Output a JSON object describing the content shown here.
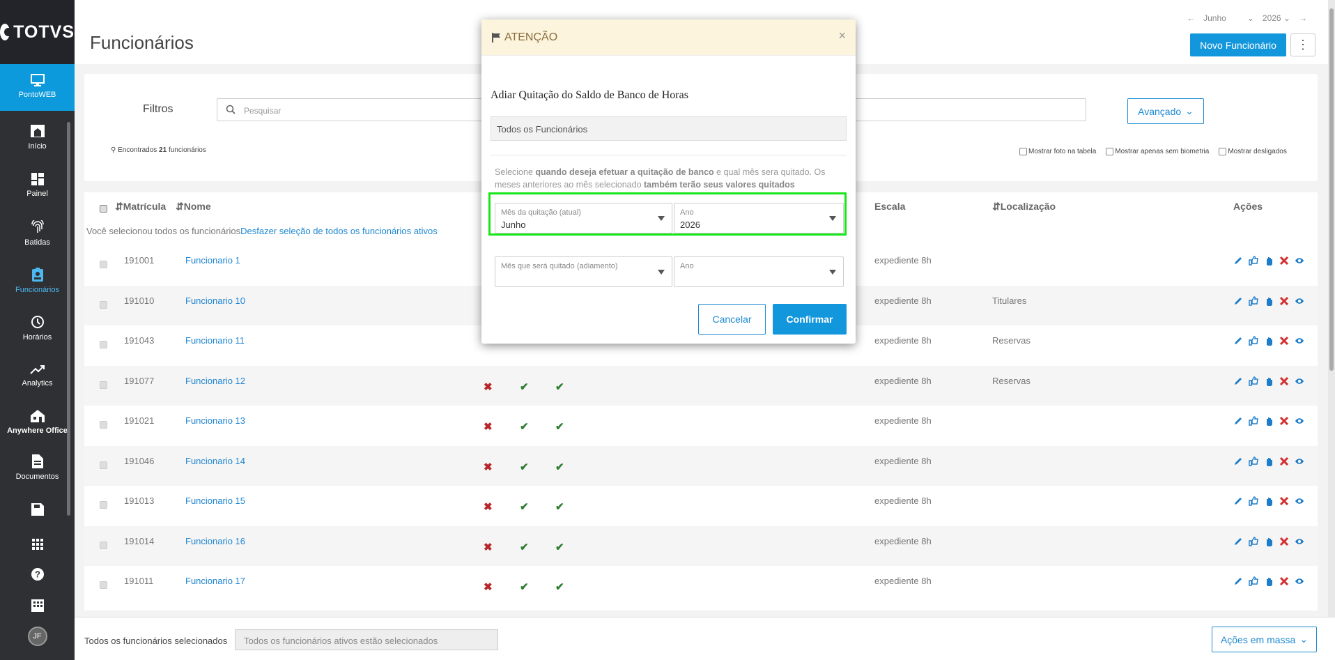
{
  "sidebar": {
    "brand": "TOTVS",
    "items": [
      {
        "label": "PontoWEB"
      },
      {
        "label": "Início"
      },
      {
        "label": "Painel"
      },
      {
        "label": "Batidas"
      },
      {
        "label": "Funcionários"
      },
      {
        "label": "Horários"
      },
      {
        "label": "Analytics"
      },
      {
        "label": "Anywhere Office"
      },
      {
        "label": "Documentos"
      }
    ],
    "avatar": "JF"
  },
  "header": {
    "title": "Funcionários",
    "month": "Junho",
    "year": "2026",
    "new_button": "Novo Funcionário"
  },
  "filters": {
    "label": "Filtros",
    "search_placeholder": "Pesquisar",
    "advanced": "Avançado",
    "found_prefix": "Encontrados ",
    "found_count": "21",
    "found_suffix": " funcionários",
    "check_photo": "Mostrar foto na tabela",
    "check_biometry": "Mostrar apenas sem biometria",
    "check_dismissed": "Mostrar desligados"
  },
  "table": {
    "headers": {
      "matricula": "Matrícula",
      "nome": "Nome",
      "escala": "Escala",
      "localizacao": "Localização",
      "acoes": "Ações"
    },
    "selection_text": "Você selecionou todos os funcionários",
    "selection_link": "Desfazer seleção de todos os funcionários ativos",
    "rows": [
      {
        "matricula": "191001",
        "nome": "Funcionario 1",
        "escala": "expediente 8h",
        "localizacao": ""
      },
      {
        "matricula": "191010",
        "nome": "Funcionario 10",
        "escala": "expediente 8h",
        "localizacao": "Titulares"
      },
      {
        "matricula": "191043",
        "nome": "Funcionario 11",
        "escala": "expediente 8h",
        "localizacao": "Reservas"
      },
      {
        "matricula": "191077",
        "nome": "Funcionario 12",
        "escala": "expediente 8h",
        "localizacao": "Reservas"
      },
      {
        "matricula": "191021",
        "nome": "Funcionario 13",
        "escala": "expediente 8h",
        "localizacao": ""
      },
      {
        "matricula": "191046",
        "nome": "Funcionario 14",
        "escala": "expediente 8h",
        "localizacao": ""
      },
      {
        "matricula": "191013",
        "nome": "Funcionario 15",
        "escala": "expediente 8h",
        "localizacao": ""
      },
      {
        "matricula": "191014",
        "nome": "Funcionario 16",
        "escala": "expediente 8h",
        "localizacao": ""
      },
      {
        "matricula": "191011",
        "nome": "Funcionario 17",
        "escala": "expediente 8h",
        "localizacao": ""
      }
    ]
  },
  "footer": {
    "label": "Todos os funcionários selecionados",
    "input_value": "Todos os funcionários ativos estão selecionados",
    "mass_actions": "Ações em massa"
  },
  "modal": {
    "title": "ATENÇÃO",
    "close": "×",
    "heading": "Adiar Quitação do Saldo de Banco de Horas",
    "employees_box": "Todos os Funcionários",
    "desc": {
      "p1": "Selecione ",
      "b1": "quando deseja efetuar a quitação de banco",
      "p2": " e qual mês sera quitado. Os meses anteriores ao mês selecionado ",
      "b2": "também terão seus valores quitados"
    },
    "month_label": "Mês da quitação (atual)",
    "month_value": "Junho",
    "year_label": "Ano",
    "year_value": "2026",
    "defer_month_label": "Mês que será quitado (adiamento)",
    "defer_year_label": "Ano",
    "cancel": "Cancelar",
    "confirm": "Confirmar"
  }
}
